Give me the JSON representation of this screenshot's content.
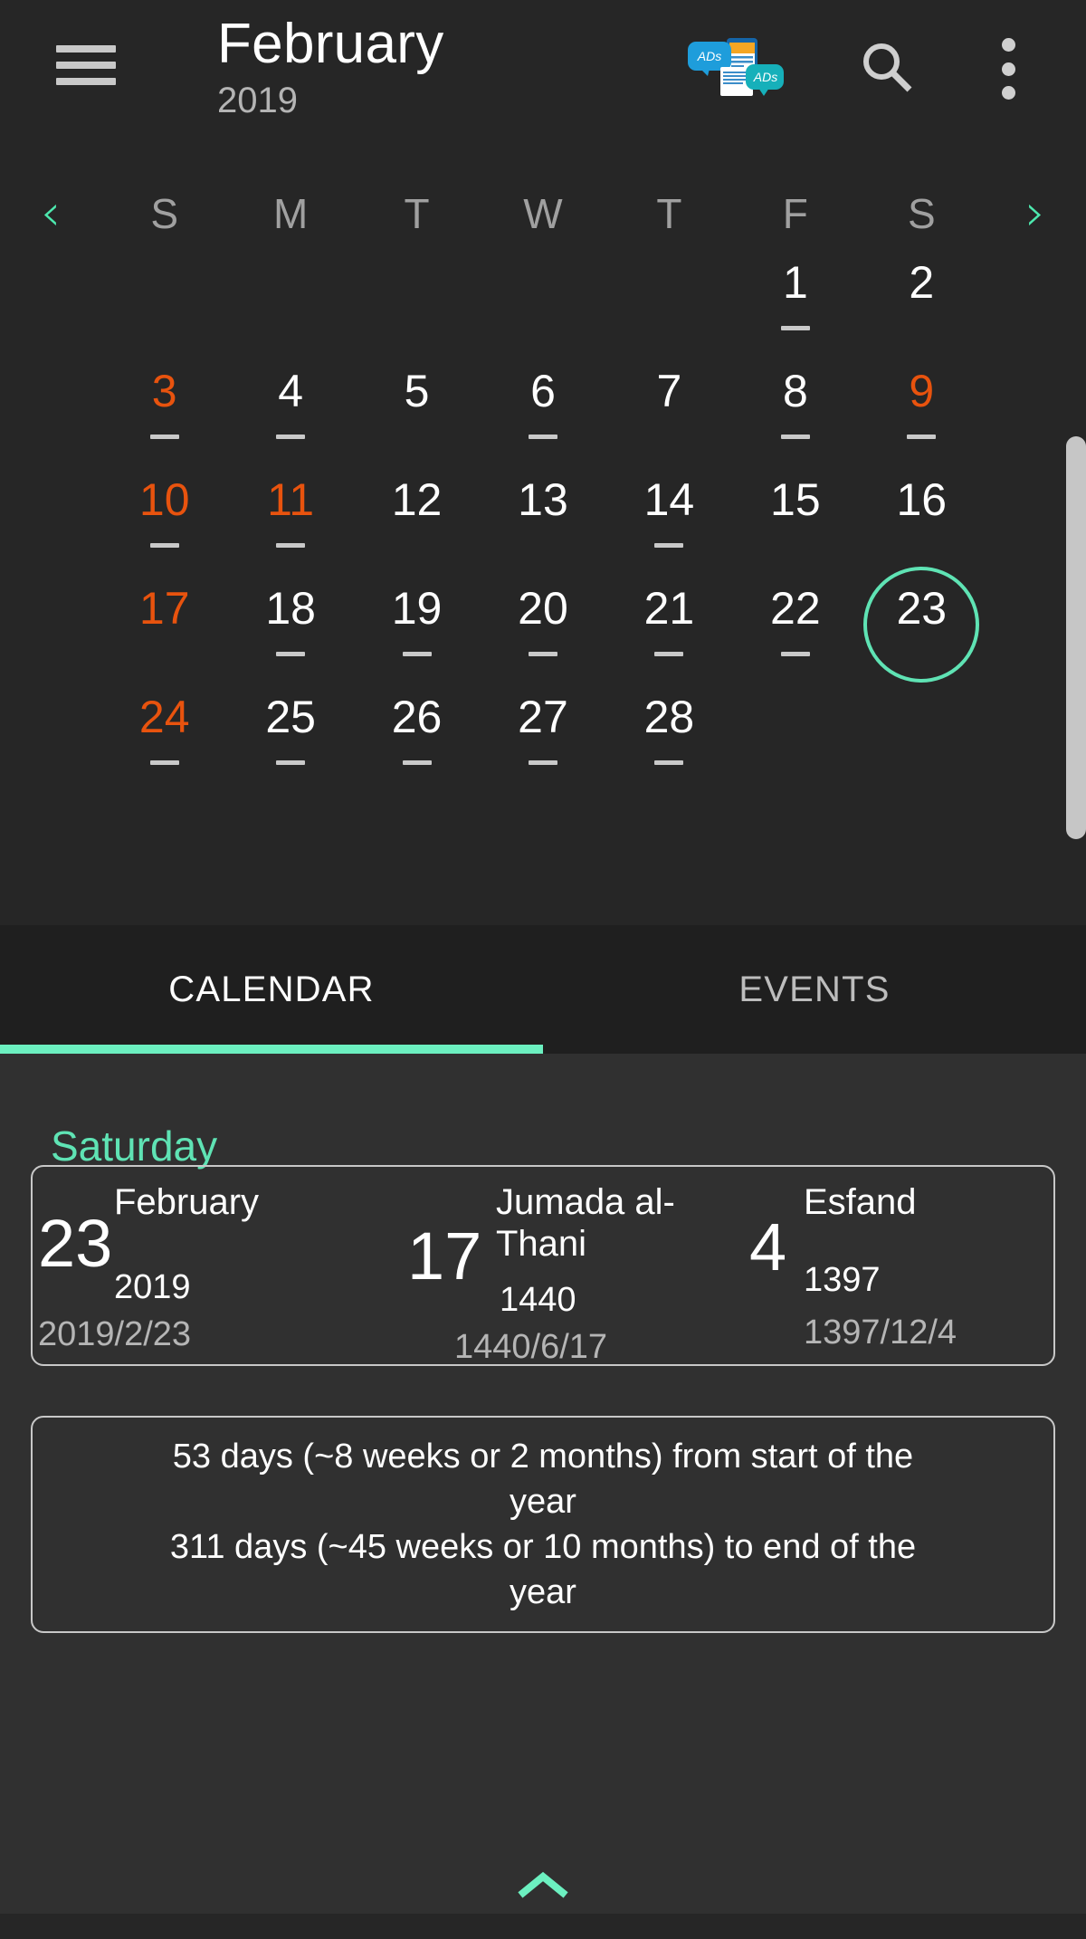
{
  "appbar": {
    "menu_icon": "hamburger-menu-icon",
    "title_month": "February",
    "title_year": "2019",
    "ads_icon": "ads-icon",
    "ads_label_1": "ADs",
    "ads_label_2": "ADs",
    "search_icon": "search-icon",
    "overflow_icon": "more-vertical-icon"
  },
  "calendar": {
    "prev_arrow": "‹",
    "next_arrow": "›",
    "weekdays": [
      "S",
      "M",
      "T",
      "W",
      "T",
      "F",
      "S"
    ],
    "selected_day": 23,
    "leading_blanks": 5,
    "days": [
      {
        "n": 1,
        "holiday": false,
        "event": true
      },
      {
        "n": 2,
        "holiday": false,
        "event": false
      },
      {
        "n": 3,
        "holiday": true,
        "event": true
      },
      {
        "n": 4,
        "holiday": false,
        "event": true
      },
      {
        "n": 5,
        "holiday": false,
        "event": false
      },
      {
        "n": 6,
        "holiday": false,
        "event": true
      },
      {
        "n": 7,
        "holiday": false,
        "event": false
      },
      {
        "n": 8,
        "holiday": false,
        "event": true
      },
      {
        "n": 9,
        "holiday": true,
        "event": true
      },
      {
        "n": 10,
        "holiday": true,
        "event": true
      },
      {
        "n": 11,
        "holiday": true,
        "event": true
      },
      {
        "n": 12,
        "holiday": false,
        "event": false
      },
      {
        "n": 13,
        "holiday": false,
        "event": false
      },
      {
        "n": 14,
        "holiday": false,
        "event": true
      },
      {
        "n": 15,
        "holiday": false,
        "event": false
      },
      {
        "n": 16,
        "holiday": false,
        "event": false
      },
      {
        "n": 17,
        "holiday": true,
        "event": false
      },
      {
        "n": 18,
        "holiday": false,
        "event": true
      },
      {
        "n": 19,
        "holiday": false,
        "event": true
      },
      {
        "n": 20,
        "holiday": false,
        "event": true
      },
      {
        "n": 21,
        "holiday": false,
        "event": true
      },
      {
        "n": 22,
        "holiday": false,
        "event": true
      },
      {
        "n": 23,
        "holiday": false,
        "event": false
      },
      {
        "n": 24,
        "holiday": true,
        "event": true
      },
      {
        "n": 25,
        "holiday": false,
        "event": true
      },
      {
        "n": 26,
        "holiday": false,
        "event": true
      },
      {
        "n": 27,
        "holiday": false,
        "event": true
      },
      {
        "n": 28,
        "holiday": false,
        "event": true
      }
    ]
  },
  "tabs": [
    {
      "label": "CALENDAR",
      "active": true
    },
    {
      "label": "EVENTS",
      "active": false
    }
  ],
  "details": {
    "day_name": "Saturday",
    "dates": [
      {
        "day": "23",
        "month": "February",
        "year": "2019",
        "full": "2019/2/23"
      },
      {
        "day": "17",
        "month": "Jumada al-Thani",
        "year": "1440",
        "full": "1440/6/17"
      },
      {
        "day": "4",
        "month": "Esfand",
        "year": "1397",
        "full": "1397/12/4"
      }
    ],
    "info_lines": [
      "53 days (~8 weeks or 2 months) from start of the year",
      "311 days (~45 weeks or 10 months) to end of the year"
    ],
    "expand_chevron": "⌃"
  },
  "colors": {
    "accent_mint": "#5fe3b4",
    "holiday_orange": "#e8530e",
    "background": "#262626",
    "content_background": "#303030"
  }
}
